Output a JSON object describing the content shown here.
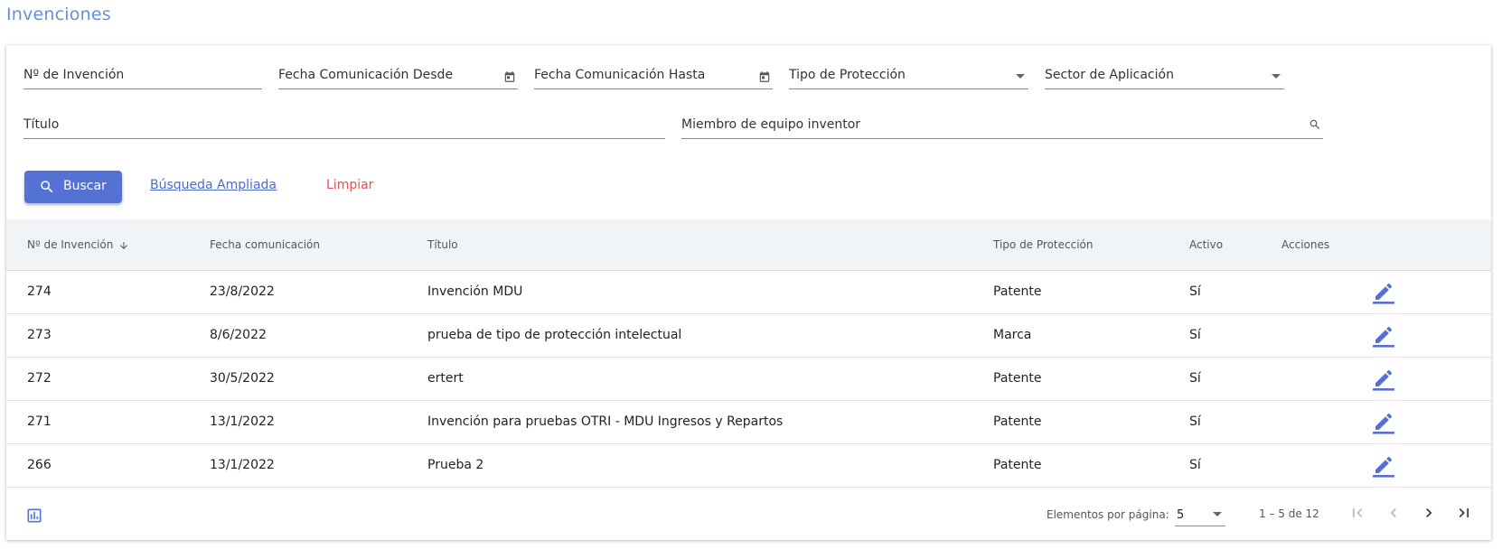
{
  "page": {
    "title": "Invenciones"
  },
  "filters": {
    "invention_number": "Nº de Invención",
    "date_from": "Fecha Comunicación Desde",
    "date_to": "Fecha Comunicación Hasta",
    "protection_type": "Tipo de Protección",
    "application_sector": "Sector de Aplicación",
    "title": "Título",
    "team_member": "Miembro de equipo inventor"
  },
  "actions": {
    "search": "Buscar",
    "advanced_search": "Búsqueda Ampliada",
    "clear": "Limpiar"
  },
  "table": {
    "headers": {
      "number": "Nº de Invención",
      "date": "Fecha comunicación",
      "title": "Título",
      "protection": "Tipo de Protección",
      "active": "Activo",
      "actions": "Acciones"
    },
    "rows": [
      {
        "number": "274",
        "date": "23/8/2022",
        "title": "Invención MDU",
        "protection": "Patente",
        "active": "Sí"
      },
      {
        "number": "273",
        "date": "8/6/2022",
        "title": "prueba de tipo de protección intelectual",
        "protection": "Marca",
        "active": "Sí"
      },
      {
        "number": "272",
        "date": "30/5/2022",
        "title": "ertert",
        "protection": "Patente",
        "active": "Sí"
      },
      {
        "number": "271",
        "date": "13/1/2022",
        "title": "Invención para pruebas OTRI - MDU Ingresos y Repartos",
        "protection": "Patente",
        "active": "Sí"
      },
      {
        "number": "266",
        "date": "13/1/2022",
        "title": "Prueba 2",
        "protection": "Patente",
        "active": "Sí"
      }
    ]
  },
  "pagination": {
    "per_page_label": "Elementos por página:",
    "per_page_value": "5",
    "range": "1 – 5 de 12"
  },
  "colors": {
    "accent": "#5472d3",
    "title": "#6a8ed6",
    "danger": "#e55353",
    "header_bg": "#f1f4f7"
  },
  "icons": {
    "date_picker": "calendar-icon",
    "dropdown": "chevron-down-icon",
    "search": "search-icon",
    "sort": "arrow-down-icon",
    "edit": "pencil-icon",
    "chart": "bar-chart-icon",
    "first": "first-page-icon",
    "prev": "chevron-left-icon",
    "next": "chevron-right-icon",
    "last": "last-page-icon"
  }
}
